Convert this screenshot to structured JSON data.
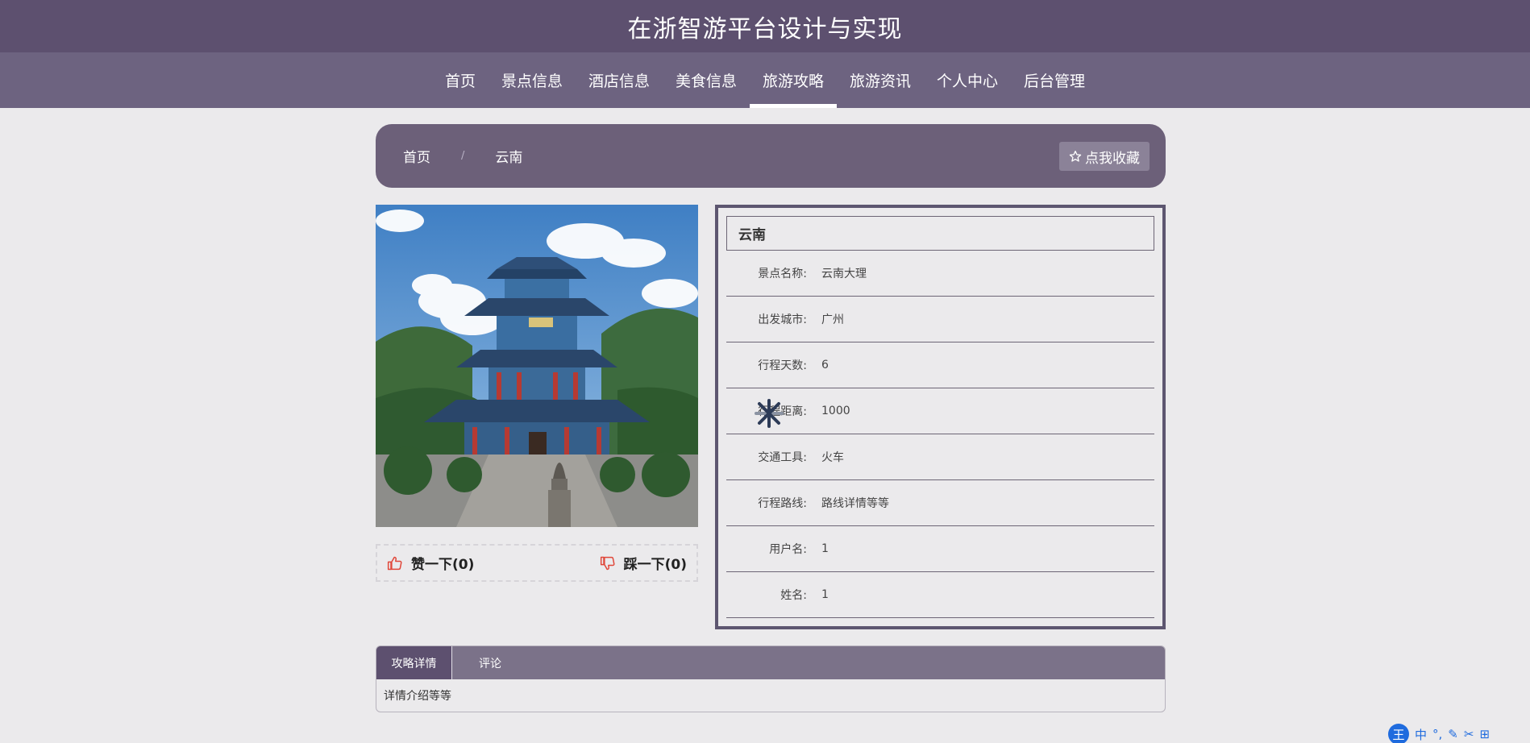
{
  "header": {
    "title": "在浙智游平台设计与实现"
  },
  "nav": {
    "items": [
      {
        "label": "首页"
      },
      {
        "label": "景点信息"
      },
      {
        "label": "酒店信息"
      },
      {
        "label": "美食信息"
      },
      {
        "label": "旅游攻略"
      },
      {
        "label": "旅游资讯"
      },
      {
        "label": "个人中心"
      },
      {
        "label": "后台管理"
      }
    ],
    "active": "旅游攻略"
  },
  "breadcrumb": {
    "home": "首页",
    "separator": "/",
    "current": "云南",
    "favorite_label": "点我收藏",
    "favorite_icon": "star-outline-icon"
  },
  "photo": {
    "alt": "云南大理 楼阁"
  },
  "votes": {
    "like_label": "赞一下(0)",
    "dislike_label": "踩一下(0)",
    "like_icon": "thumbs-up-icon",
    "dislike_icon": "thumbs-down-icon",
    "icon_color": "#e0473a"
  },
  "info": {
    "title": "云南",
    "rows": [
      {
        "label": "景点名称:",
        "value": "云南大理"
      },
      {
        "label": "出发城市:",
        "value": "广州"
      },
      {
        "label": "行程天数:",
        "value": "6"
      },
      {
        "label": "行程距离:",
        "value": "1000"
      },
      {
        "label": "交通工具:",
        "value": "火车"
      },
      {
        "label": "行程路线:",
        "value": "路线详情等等"
      },
      {
        "label": "用户名:",
        "value": "1"
      },
      {
        "label": "姓名:",
        "value": "1"
      }
    ]
  },
  "tabs": {
    "items": [
      {
        "label": "攻略详情"
      },
      {
        "label": "评论"
      }
    ],
    "active": "攻略详情",
    "content": "详情介绍等等"
  },
  "ime": {
    "logo": "王",
    "items": [
      "中",
      "°,",
      "✎",
      "✂",
      "⊞"
    ]
  },
  "colors": {
    "header_bg": "#5d506f",
    "nav_bg": "#6d6380",
    "panel_bg": "#6c6079",
    "page_bg": "#ebeaec"
  }
}
